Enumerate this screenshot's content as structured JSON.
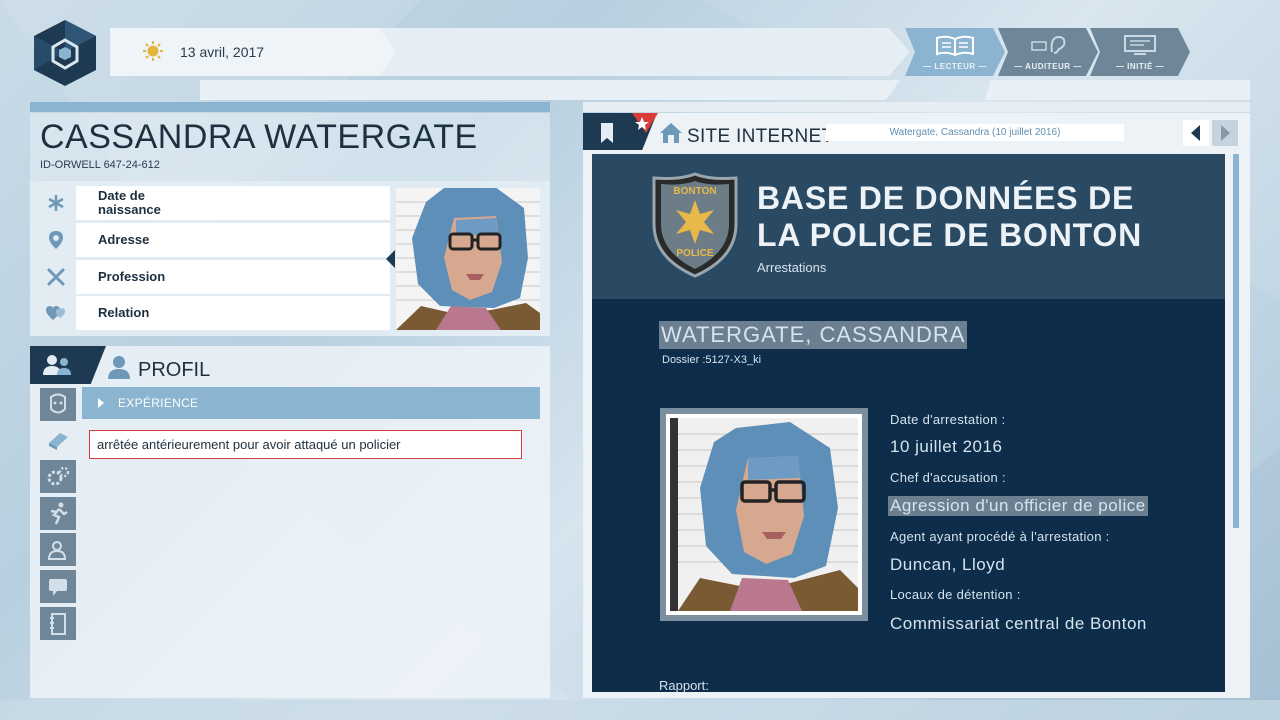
{
  "header": {
    "date": "13 avril, 2017",
    "modes": [
      {
        "label": "— LECTEUR —",
        "icon": "book-icon",
        "active": true
      },
      {
        "label": "— AUDITEUR —",
        "icon": "ear-icon",
        "active": false
      },
      {
        "label": "— INITIÉ —",
        "icon": "monitor-icon",
        "active": false
      }
    ]
  },
  "person": {
    "name": "CASSANDRA WATERGATE",
    "id": "ID-ORWELL  647-24-612",
    "fields": [
      {
        "label": "Date de\nnaissance",
        "icon": "asterisk-icon"
      },
      {
        "label": "Adresse",
        "icon": "location-pin-icon"
      },
      {
        "label": "Profession",
        "icon": "tools-icon"
      },
      {
        "label": "Relation",
        "icon": "hearts-icon"
      }
    ]
  },
  "profile": {
    "title": "PROFIL",
    "category": "EXPÉRIENCE",
    "entry": "arrêtée antérieurement pour avoir attaqué un policier",
    "side_icons": [
      "face-icon",
      "book-icon",
      "gears-icon",
      "runner-icon",
      "person-card-icon",
      "speech-icon",
      "notebook-icon"
    ]
  },
  "browser": {
    "site_label": "SITE INTERNET",
    "url": "Watergate, Cassandra (10 juillet 2016)"
  },
  "site": {
    "badge_top": "BONTON",
    "badge_bottom": "POLICE",
    "title_line1": "BASE DE DONNÉES DE",
    "title_line2": "LA POLICE DE BONTON",
    "subtitle": "Arrestations",
    "record_name": "WATERGATE, CASSANDRA",
    "dossier": "Dossier :5127-X3_ki",
    "fields": [
      {
        "label": "Date d'arrestation :",
        "value": "10 juillet 2016",
        "highlight": false
      },
      {
        "label": "Chef d'accusation :",
        "value": "Agression d'un officier de police",
        "highlight": true
      },
      {
        "label": "Agent ayant procédé à l'arrestation :",
        "value": "Duncan, Lloyd",
        "highlight": false
      },
      {
        "label": "Locaux de détention :",
        "value": "Commissariat central de Bonton",
        "highlight": false
      }
    ],
    "rapport": "Rapport:"
  },
  "colors": {
    "accent": "#8ab4d0",
    "dark_navy": "#1d3a52",
    "site_header": "#2a4a64",
    "site_body": "#0d2d4a",
    "highlight": "#6c7f91",
    "selected_border": "#d93a3a"
  }
}
